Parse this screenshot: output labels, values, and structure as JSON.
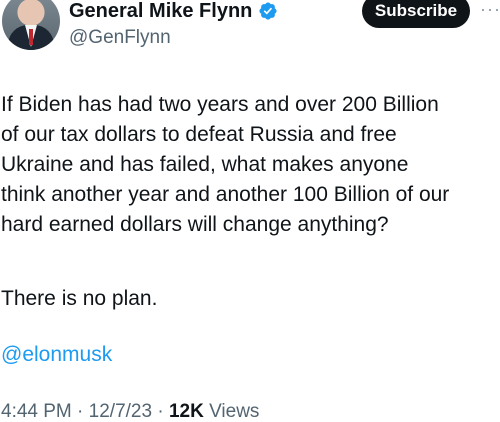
{
  "author": {
    "display_name": "General Mike Flynn",
    "handle": "@GenFlynn",
    "verified_icon": "verified-badge-icon",
    "verified_color": "#1d9bf0"
  },
  "subscribe_label": "Subscribe",
  "more_icon": "···",
  "tweet": {
    "lines": [
      "If Biden has had two years and over 200 Billion",
      "of our tax dollars to defeat Russia and free",
      "Ukraine and has failed, what makes anyone",
      "think another year and another 100 Billion of our",
      "hard earned dollars will change anything?"
    ],
    "closing": "There is no plan.",
    "mention": "@elonmusk"
  },
  "meta": {
    "time": "4:44 PM",
    "sep1": " · ",
    "date": "12/7/23",
    "sep2": " · ",
    "views_count": "12K",
    "views_label": " Views"
  },
  "colors": {
    "link": "#1d9bf0",
    "muted": "#536471",
    "text": "#0f1419"
  }
}
